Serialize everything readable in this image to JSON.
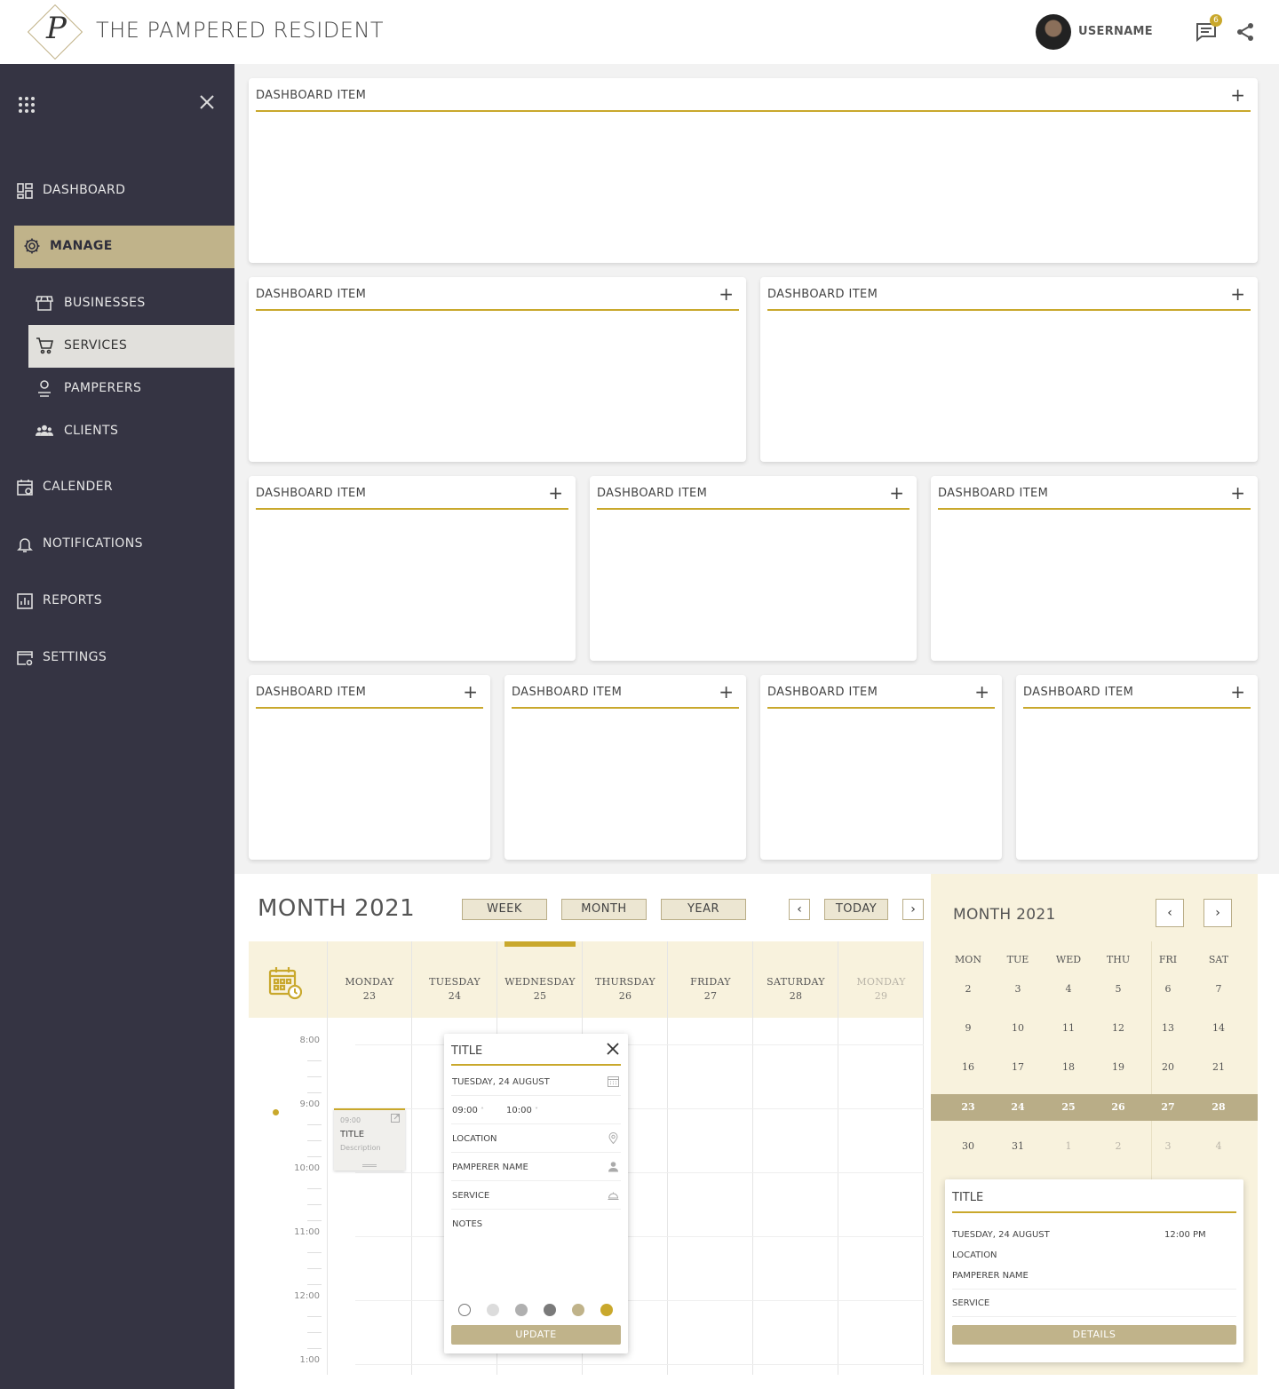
{
  "header": {
    "logo_letter": "P",
    "brand": "THE PAMPERED RESIDENT",
    "username": "USERNAME",
    "message_count": "6"
  },
  "sidebar": {
    "items": [
      {
        "label": "DASHBOARD",
        "icon": "dashboard-icon"
      },
      {
        "label": "MANAGE",
        "icon": "gear-icon",
        "active": true
      },
      {
        "label": "BUSINESSES",
        "icon": "store-icon"
      },
      {
        "label": "SERVICES",
        "icon": "cart-icon",
        "selected": true
      },
      {
        "label": "PAMPERERS",
        "icon": "person-icon"
      },
      {
        "label": "CLIENTS",
        "icon": "group-icon"
      },
      {
        "label": "CALENDER",
        "icon": "calendar-icon"
      },
      {
        "label": "NOTIFICATIONS",
        "icon": "bell-icon"
      },
      {
        "label": "REPORTS",
        "icon": "report-icon"
      },
      {
        "label": "SETTINGS",
        "icon": "settings-window-icon"
      }
    ]
  },
  "dashboard": {
    "card_title": "DASHBOARD ITEM",
    "add_symbol": "+"
  },
  "calendar": {
    "title": "MONTH 2021",
    "views": [
      "WEEK",
      "MONTH",
      "YEAR"
    ],
    "today_label": "TODAY",
    "prev_symbol": "‹",
    "next_symbol": "›",
    "days": [
      {
        "name": "MONDAY",
        "date": "23"
      },
      {
        "name": "TUESDAY",
        "date": "24"
      },
      {
        "name": "WEDNESDAY",
        "date": "25"
      },
      {
        "name": "THURSDAY",
        "date": "26"
      },
      {
        "name": "FRIDAY",
        "date": "27"
      },
      {
        "name": "SATURDAY",
        "date": "28"
      },
      {
        "name": "MONDAY",
        "date": "29"
      }
    ],
    "hours": [
      "8:00",
      "9:00",
      "10:00",
      "11:00",
      "12:00",
      "1:00"
    ],
    "event": {
      "time": "09:00",
      "title": "TITLE",
      "description": "Description"
    },
    "popup": {
      "title": "TITLE",
      "date": "TUESDAY, 24 AUGUST",
      "start": "09:00",
      "end": "10:00",
      "location": "LOCATION",
      "pamperer": "PAMPERER NAME",
      "service": "SERVICE",
      "notes": "NOTES",
      "swatches": [
        "#ffffff",
        "#dcdcdc",
        "#b0b0b0",
        "#7a7a7a",
        "#c0b38a",
        "#c9a82c"
      ],
      "update_label": "UPDATE"
    }
  },
  "mini_calendar": {
    "title": "MONTH 2021",
    "dow": [
      "MON",
      "TUE",
      "WED",
      "THU",
      "FRI",
      "SAT"
    ],
    "weeks": [
      [
        "2",
        "3",
        "4",
        "5",
        "6",
        "7"
      ],
      [
        "9",
        "10",
        "11",
        "12",
        "13",
        "14"
      ],
      [
        "16",
        "17",
        "18",
        "19",
        "20",
        "21"
      ],
      [
        "23",
        "24",
        "25",
        "26",
        "27",
        "28"
      ],
      [
        "30",
        "31",
        "1",
        "2",
        "3",
        "4"
      ]
    ],
    "details": {
      "title": "TITLE",
      "date": "TUESDAY, 24 AUGUST",
      "time": "12:00 PM",
      "location": "LOCATION",
      "pamperer": "PAMPERER NAME",
      "service": "SERVICE",
      "details_label": "DETAILS"
    }
  },
  "colors": {
    "sidebar": "#353443",
    "accent": "#c9a82c",
    "tan": "#c0b38a",
    "cream": "#f8f2dd"
  }
}
